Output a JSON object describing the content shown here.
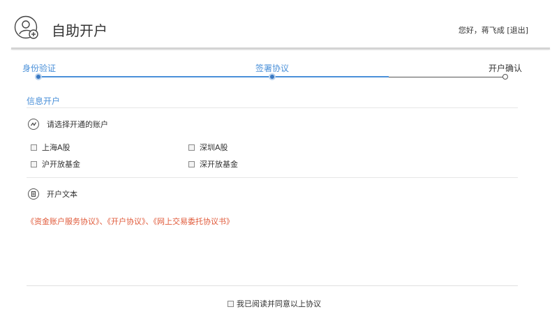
{
  "header": {
    "title": "自助开户",
    "greeting": "您好，蒋飞成",
    "logout_label": "[退出]"
  },
  "stepper": {
    "steps": [
      {
        "label": "身份验证",
        "state": "done"
      },
      {
        "label": "签署协议",
        "state": "current"
      },
      {
        "label": "开户确认",
        "state": "todo"
      }
    ],
    "progress_percent": 75
  },
  "section": {
    "title": "信息开户"
  },
  "accounts": {
    "heading": "请选择开通的账户",
    "options": [
      {
        "label": "上海A股",
        "checked": false
      },
      {
        "label": "深圳A股",
        "checked": false
      },
      {
        "label": "沪开放基金",
        "checked": false
      },
      {
        "label": "深开放基金",
        "checked": false
      }
    ]
  },
  "text_section": {
    "heading": "开户文本",
    "agreements": "《资金账户服务协议》、《开户协议》、《网上交易委托协议书》"
  },
  "agree": {
    "label": "我已阅读并同意以上协议",
    "checked": false
  },
  "colors": {
    "accent": "#4a90d9",
    "link_red": "#e05a3a"
  }
}
